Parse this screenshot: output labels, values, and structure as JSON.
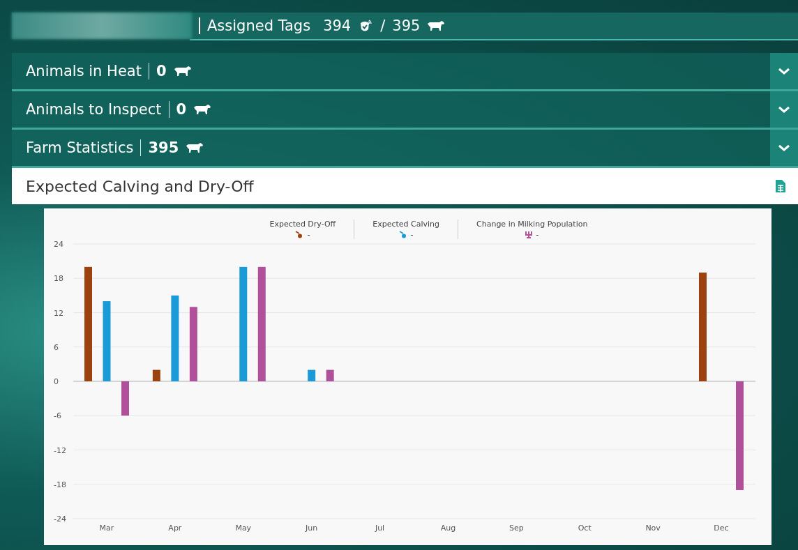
{
  "header": {
    "title": "Assigned Tags",
    "tag_count": "394",
    "separator": "/",
    "animal_count": "395"
  },
  "sections": [
    {
      "title": "Animals in Heat",
      "count": "0",
      "expanded": false
    },
    {
      "title": "Animals to Inspect",
      "count": "0",
      "expanded": false
    },
    {
      "title": "Farm Statistics",
      "count": "395",
      "expanded": false
    }
  ],
  "panel": {
    "title": "Expected Calving and Dry-Off",
    "legend": [
      {
        "value": "-"
      },
      {
        "value": "-"
      },
      {
        "value": "-"
      }
    ],
    "chart_data": {
      "type": "bar",
      "categories": [
        "Mar",
        "Apr",
        "May",
        "Jun",
        "Jul",
        "Aug",
        "Sep",
        "Oct",
        "Nov",
        "Dec"
      ],
      "series": [
        {
          "name": "Expected Dry-Off",
          "color": "#9c420e",
          "values": [
            20,
            2,
            0,
            0,
            0,
            0,
            0,
            0,
            0,
            19
          ]
        },
        {
          "name": "Expected Calving",
          "color": "#1a9ad6",
          "values": [
            14,
            15,
            20,
            2,
            0,
            0,
            0,
            0,
            0,
            0
          ]
        },
        {
          "name": "Change in Milking Population",
          "color": "#b04f9a",
          "values": [
            -6,
            13,
            20,
            2,
            0,
            0,
            0,
            0,
            0,
            -19
          ]
        }
      ],
      "grid": true,
      "ylim": [
        -24,
        24
      ],
      "yticks": [
        24,
        18,
        12,
        6,
        0,
        -6,
        -12,
        -18,
        -24
      ]
    }
  }
}
